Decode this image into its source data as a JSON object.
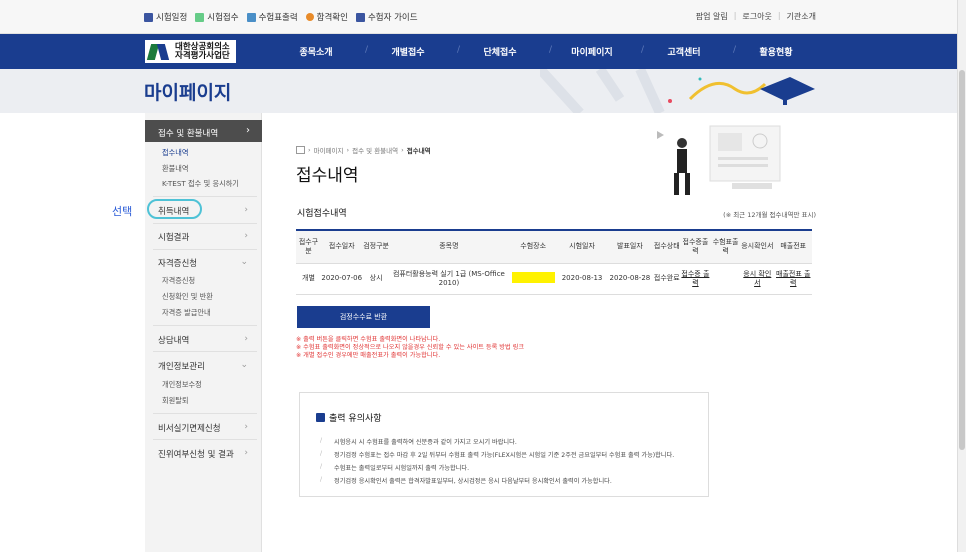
{
  "top_links": [
    "시험일정",
    "시험접수",
    "수험표출력",
    "합격확인",
    "수험자 가이드"
  ],
  "top_right": [
    "팝업 알림",
    "로그아웃",
    "기관소개"
  ],
  "logo": {
    "line1": "대한상공회의소",
    "line2": "자격평가사업단"
  },
  "nav": [
    "종목소개",
    "개별접수",
    "단체접수",
    "마이페이지",
    "고객센터",
    "활용현황"
  ],
  "page_title": "마이페이지",
  "sidebar": {
    "head": "접수 및 환불내역",
    "head_subs": [
      "접수내역",
      "환불내역",
      "K-TEST 접수 및 응시하기"
    ],
    "cancel": "취득내역",
    "result": "시험결과",
    "cert": "자격증신청",
    "cert_subs": [
      "자격증신청",
      "신청확인 및 반환",
      "자격증 발급안내"
    ],
    "consult": "상담내역",
    "personal": "개인정보관리",
    "personal_subs": [
      "개인정보수정",
      "회원탈퇴"
    ],
    "exempt": "비서실기면제신청",
    "career": "진위여부신청 및 결과"
  },
  "annotation": "선택",
  "breadcrumb": [
    "마이페이지",
    "접수 및 환불내역",
    "접수내역"
  ],
  "content_title": "접수내역",
  "section_title": "시험접수내역",
  "section_note": "(※ 최근 12개월 접수내역만 표시)",
  "table": {
    "headers": [
      "접수구분",
      "접수일자",
      "검정구분",
      "종목명",
      "수험장소",
      "시험일자",
      "발표일자",
      "접수상태",
      "접수증출력",
      "수험표출력",
      "응시확인서",
      "매출전표"
    ],
    "row": [
      "개별",
      "2020-07-06",
      "상시",
      "컴퓨터활용능력 실기 1급 (MS-Office 2010)",
      "",
      "2020-08-13",
      "2020-08-28",
      "접수완료",
      "접수증 출력",
      "",
      "응시 확인서",
      "매출전표 출력"
    ]
  },
  "refund_button": "검정수수료 반환",
  "red_notes": [
    "※ 출력 버튼을 클릭하면 수험표 출력화면이 나타납니다.",
    "※ 수험표 출력화면이 정상적으로 나오지 않을경우 신뢰할 수 있는 사이트 등록 방법 링크",
    "※ 개별 접수인 경우에만 매출전표가 출력이 가능합니다."
  ],
  "notice": {
    "title": "출력 유의사항",
    "lines": [
      "시험응시 시 수험표를 출력하여 신분증과 같이 가지고 오시기 바랍니다.",
      "정기검정 수험표는 접수 마감 후 2일 뒤부터 수험표 출력 가능(FLEX시험은 시험일 기준 2주전 금요일부터 수험표 출력 가능)합니다.",
      "수험표는 출력일로부터 시험일까지 출력 가능합니다.",
      "정기검정 응시확인서 출력은 합격자발표일부터, 상시검정은 응시 다음날부터 응시확인서 출력이 가능합니다."
    ]
  }
}
